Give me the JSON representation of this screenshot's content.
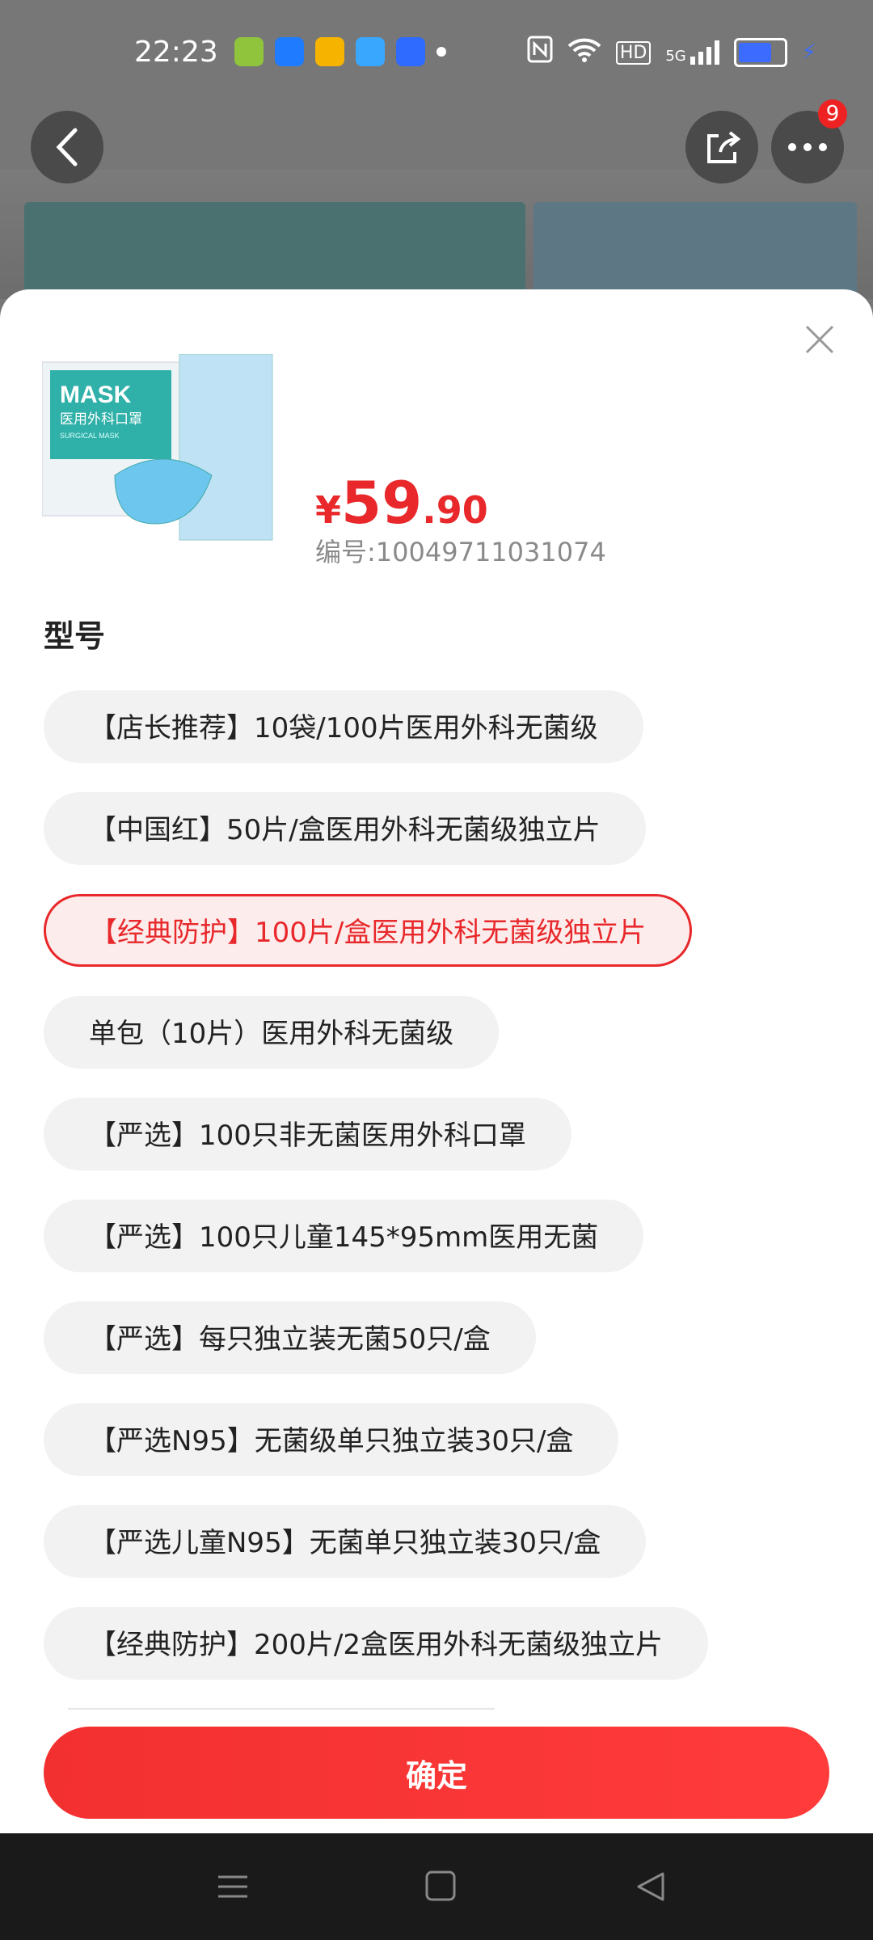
{
  "status": {
    "time": "22:23",
    "app_icons": [
      "app-icon-1",
      "app-icon-2",
      "weibo-icon",
      "app-icon-4",
      "baidu-icon"
    ],
    "hd": "HD",
    "network": "5G",
    "battery_level": 0.75,
    "battery_color": "#3b6bff"
  },
  "header": {
    "back_icon": "back-icon",
    "share_icon": "share-icon",
    "more_icon": "more-icon",
    "more_badge": "9"
  },
  "sheet": {
    "close_icon": "close-icon",
    "product": {
      "image_text_main": "MASK",
      "image_text_sub": "医用外科口罩",
      "image_text_en": "SURGICAL MASK",
      "price_currency": "¥",
      "price_int": "59",
      "price_dec": ".90",
      "sku_code": "编号:10049711031074"
    },
    "section_title": "型号",
    "options": [
      {
        "label": "【店长推荐】10袋/100片医用外科无菌级",
        "selected": false
      },
      {
        "label": "【中国红】50片/盒医用外科无菌级独立片",
        "selected": false
      },
      {
        "label": "【经典防护】100片/盒医用外科无菌级独立片",
        "selected": true
      },
      {
        "label": "单包（10片）医用外科无菌级",
        "selected": false
      },
      {
        "label": "【严选】100只非无菌医用外科口罩",
        "selected": false
      },
      {
        "label": "【严选】100只儿童145*95mm医用无菌",
        "selected": false
      },
      {
        "label": "【严选】每只独立装无菌50只/盒",
        "selected": false
      },
      {
        "label": "【严选N95】无菌级单只独立装30只/盒",
        "selected": false
      },
      {
        "label": "【严选儿童N95】无菌单只独立装30只/盒",
        "selected": false
      },
      {
        "label": "【经典防护】200片/2盒医用外科无菌级独立片",
        "selected": false
      }
    ],
    "confirm_label": "确定",
    "accent_color": "#e8282b"
  },
  "nav": {
    "menu_icon": "menu-icon",
    "home_icon": "home-icon",
    "back_icon": "back-triangle-icon"
  }
}
